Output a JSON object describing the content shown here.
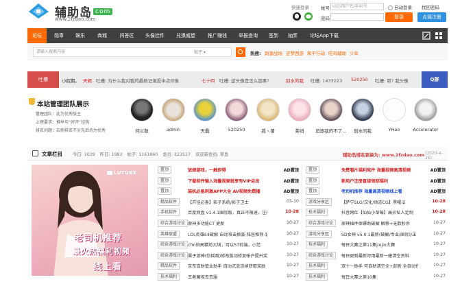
{
  "header": {
    "brand": "辅助岛",
    "brand_suffix": "com",
    "domain": "www.2fzdao.com",
    "quick_login": "快速登录",
    "account_label": "帐号",
    "account_placeholder": "UID/用户名/手机号",
    "password_label": "密码",
    "auto_login": "自动登录",
    "forgot_password": "找回密码",
    "login_button": "登录",
    "register_button": "点我注册"
  },
  "nav": {
    "items": [
      "论坛",
      "勋章",
      "娱乐",
      "商城",
      "问答区",
      "头像挂件",
      "兑换威望",
      "推广赚钱",
      "举报查询",
      "签到",
      "抽奖",
      "论坛App下载"
    ]
  },
  "search": {
    "placeholder": "请输入搜索内容",
    "select": "帖子",
    "hot_label": "热搜:",
    "hot_keywords": [
      "刺激战场",
      "逆梦西游",
      "和平行动",
      "吃鸡辅助",
      "少年"
    ]
  },
  "ticker": {
    "label": "吐槽",
    "end_button": "Q群",
    "segments": [
      {
        "text": "小假期。",
        "color": "#333"
      },
      {
        "text": "天蝎",
        "color": "#d61f1f"
      },
      {
        "text": "吐槽: 为什么我对我的最新记录投半点印象",
        "color": "#555"
      },
      {
        "text": "七十四",
        "color": "#d61f1f"
      },
      {
        "text": "吐槽: 这头像是怎么回事?",
        "color": "#555"
      },
      {
        "text": "别水的我",
        "color": "#d61f1f"
      },
      {
        "text": "吐槽: 1433223",
        "color": "#555"
      },
      {
        "text": "520250",
        "color": "#d61f1f"
      },
      {
        "text": "吐槽: 耶? 我头像",
        "color": "#555"
      }
    ]
  },
  "team": {
    "title": "本站管理团队展示",
    "lines": [
      {
        "label": "管理团队：",
        "value": "此为优秀版主"
      },
      {
        "label": "上榜要求：",
        "value": "推举与“好评”挂钩"
      },
      {
        "label": "排名问题：",
        "value": "右侧排名不分先后均为优秀"
      }
    ],
    "members": [
      "何以散",
      "admin",
      "天蠢",
      "520250",
      "孤丶猜",
      "茶绡",
      "追逐我的不了…",
      "划水的我",
      "YHao",
      "Accelerator"
    ]
  },
  "forum": {
    "title": "文章栏目",
    "stats": [
      "今日: 1039",
      "昨日: 1983",
      "帖子: 1161860",
      "会员: 223517",
      "欢迎新会员: 草鱼"
    ],
    "announcement": "辅助岛域名更换为: www.2fzdao.com",
    "announcement_date": "(2020-4-26)",
    "banner": {
      "brand": "LUTUBE",
      "line1": "老司机推荐",
      "line2": "最火热福利视频",
      "line3": "线上看"
    },
    "left_rows": [
      {
        "cat": "置顶",
        "title": "放肆游戏，一触即得",
        "title_color": "red",
        "right": "AD置顶",
        "right_style": "bold"
      },
      {
        "cat": "置顶",
        "title": "下载软件输入海量视频就享有VIP会员",
        "title_color": "red",
        "right": "AD置顶",
        "right_style": "bold"
      },
      {
        "cat": "置顶",
        "title": "装机必备刺激APP大全 AV视频免费播",
        "title_color": "red",
        "right": "AD置顶",
        "right_style": "bold"
      },
      {
        "cat": "精品软件",
        "title": "【开挂必备】影子系统/影子卫士",
        "title_color": "dark",
        "right": "05-10",
        "right_style": "normal"
      },
      {
        "cat": "手机软件",
        "title": "百度网盘 v1.4.1国际版，真正不限速，注册",
        "title_color": "dark",
        "right": "10-28",
        "right_style": "red"
      },
      {
        "cat": "综合游戏讨论",
        "title": "原神多功能CT 更新",
        "title_color": "dark",
        "right": "10-27",
        "right_style": "normal"
      },
      {
        "cat": "英雄联盟",
        "title": "LOL英雄S4破解-自动攻击换装-阵容推荐-装备合",
        "title_color": "dark",
        "right": "10-27",
        "right_style": "normal"
      },
      {
        "cat": "综合游戏讨论",
        "title": "cfm倍高精坊大境，可以57前端，小范",
        "title_color": "dark",
        "right": "10-27",
        "right_style": "normal"
      },
      {
        "cat": "综合游戏讨论",
        "title": "渠子游神(你摇哦)修改版动修复帐户提升奖",
        "title_color": "dark",
        "right": "10-27",
        "right_style": "normal"
      },
      {
        "cat": "精品软件",
        "title": "京东自助管业助手 自动沉流连续获取奖励",
        "title_color": "dark",
        "right": "10-27",
        "right_style": "normal"
      },
      {
        "cat": "技术福利",
        "title": "王者魔攻去衣服",
        "title_color": "dark",
        "right": "10-27",
        "right_style": "normal"
      }
    ],
    "right_rows": [
      {
        "cat": "置顶",
        "title": "免费看片福利软件 海量视频高清视频",
        "title_color": "red",
        "right": "AD置顶",
        "right_style": "bold"
      },
      {
        "cat": "置顶",
        "title": "新用户注册直接领取福利",
        "title_color": "red",
        "right": "AD置顶",
        "right_style": "bold"
      },
      {
        "cat": "置顶",
        "title": "老司机推荐 海量高清视频线上看",
        "title_color": "blue",
        "right": "AD置顶",
        "right_style": "bold"
      },
      {
        "cat": "游戏分享区",
        "title": "【萨宁SLG/汉化/动态CG】黑曜法",
        "title_color": "dark",
        "right": "10-28",
        "right_style": "red"
      },
      {
        "cat": "技术福利",
        "title": "抖音网红【仙仙小草莓】高价私人定制",
        "title_color": "dark",
        "right": "10-28",
        "right_style": "red"
      },
      {
        "cat": "综合游戏讨论",
        "title": "原神插件保镖助破解 解移+无数秒杀",
        "title_color": "dark",
        "right": "10-27",
        "right_style": "normal"
      },
      {
        "cat": "游戏分享区",
        "title": "SD女神 v5.0.1最新(破解/专业/国际)/正",
        "title_color": "dark",
        "right": "10-27",
        "right_style": "normal"
      },
      {
        "cat": "技术福利",
        "title": "每日大赛之第11集jiojio大赛",
        "title_color": "dark",
        "right": "10-27",
        "right_style": "normal"
      },
      {
        "cat": "综合游戏讨论",
        "title": "每日更新最新可用最新一建清空资料",
        "title_color": "dark",
        "right": "10-27",
        "right_style": "normal"
      },
      {
        "cat": "技术福利",
        "title": "双十一助手 可自助清空全+彭刷 全自动作",
        "title_color": "dark",
        "right": "10-27",
        "right_style": "normal"
      },
      {
        "cat": "技术福利",
        "title": "每日大赛之第10集",
        "title_color": "dark",
        "right": "10-27",
        "right_style": "normal"
      }
    ]
  },
  "colors": {
    "accent": "#ff6a00",
    "nav_bg": "#3f3f3f",
    "register_blue": "#2e90e0",
    "ticker_red": "#d64d4d",
    "qq_blue": "#3c5cc0",
    "title_red": "#d61f1f",
    "title_blue": "#1f4fd6"
  }
}
